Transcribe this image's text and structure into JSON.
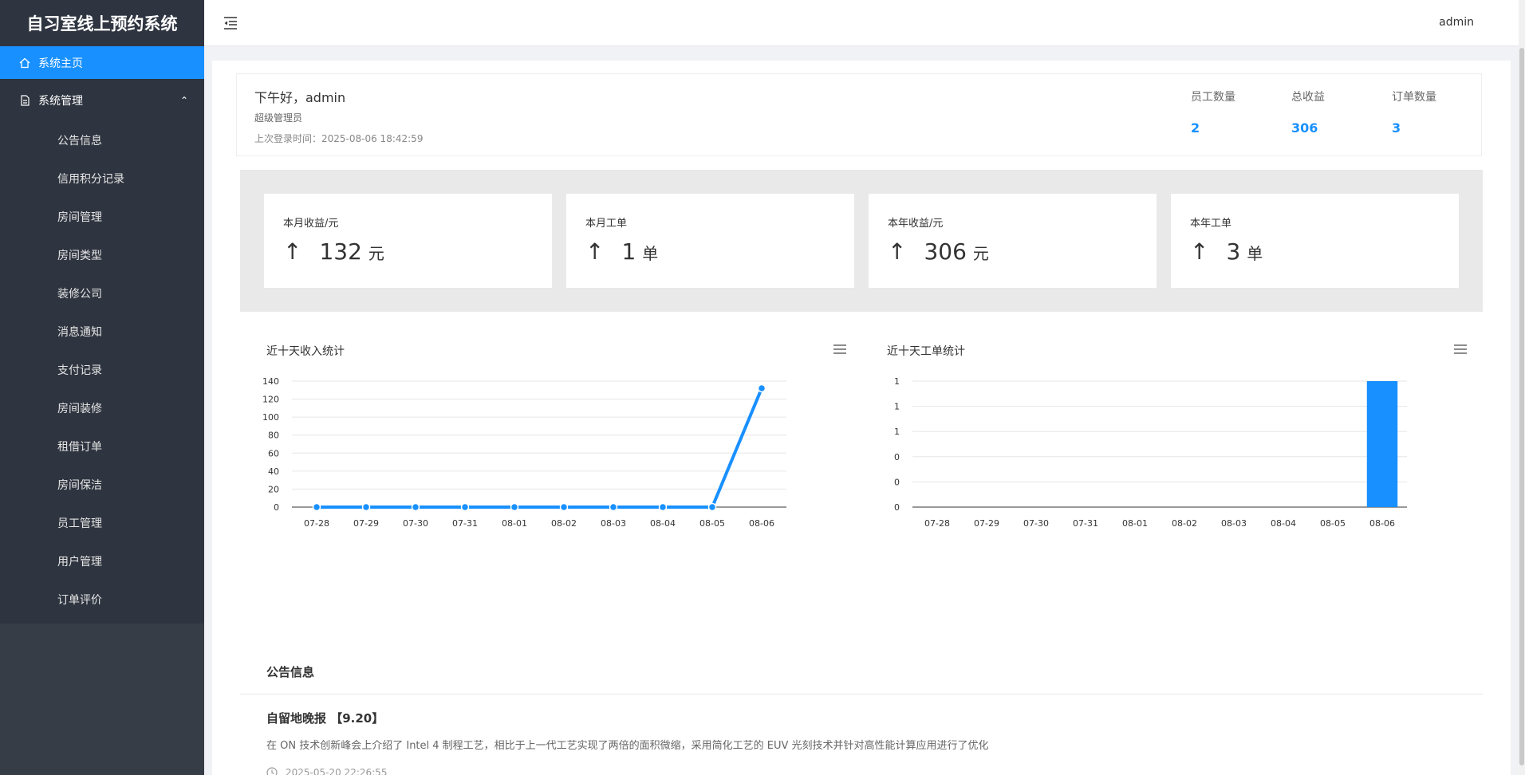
{
  "app": {
    "title": "自习室线上预约系统"
  },
  "sidebar": {
    "home_label": "系统主页",
    "group_label": "系统管理",
    "items": [
      {
        "label": "公告信息"
      },
      {
        "label": "信用积分记录"
      },
      {
        "label": "房间管理"
      },
      {
        "label": "房间类型"
      },
      {
        "label": "装修公司"
      },
      {
        "label": "消息通知"
      },
      {
        "label": "支付记录"
      },
      {
        "label": "房间装修"
      },
      {
        "label": "租借订单"
      },
      {
        "label": "房间保洁"
      },
      {
        "label": "员工管理"
      },
      {
        "label": "用户管理"
      },
      {
        "label": "订单评价"
      }
    ]
  },
  "header": {
    "user": "admin"
  },
  "welcome": {
    "greeting": "下午好，admin",
    "role": "超级管理员",
    "last_login": "上次登录时间：2025-08-06 18:42:59",
    "stats": [
      {
        "label": "员工数量",
        "value": "2"
      },
      {
        "label": "总收益",
        "value": "306"
      },
      {
        "label": "订单数量",
        "value": "3"
      }
    ]
  },
  "cards": [
    {
      "title": "本月收益/元",
      "arrow": "↑",
      "value": "132",
      "unit": "元"
    },
    {
      "title": "本月工单",
      "arrow": "↑",
      "value": "1",
      "unit": "单"
    },
    {
      "title": "本年收益/元",
      "arrow": "↑",
      "value": "306",
      "unit": "元"
    },
    {
      "title": "本年工单",
      "arrow": "↑",
      "value": "3",
      "unit": "单"
    }
  ],
  "chart_data": [
    {
      "type": "line",
      "title": "近十天收入统计",
      "x": [
        "07-28",
        "07-29",
        "07-30",
        "07-31",
        "08-01",
        "08-02",
        "08-03",
        "08-04",
        "08-05",
        "08-06"
      ],
      "values": [
        0,
        0,
        0,
        0,
        0,
        0,
        0,
        0,
        0,
        132
      ],
      "yticks": [
        "0",
        "20",
        "40",
        "60",
        "80",
        "100",
        "120",
        "140"
      ],
      "ylim": [
        0,
        140
      ],
      "color": "#1890ff",
      "grid": true
    },
    {
      "type": "bar",
      "title": "近十天工单统计",
      "x": [
        "07-28",
        "07-29",
        "07-30",
        "07-31",
        "08-01",
        "08-02",
        "08-03",
        "08-04",
        "08-05",
        "08-06"
      ],
      "values": [
        0,
        0,
        0,
        0,
        0,
        0,
        0,
        0,
        0,
        1
      ],
      "yticks": [
        "0",
        "0",
        "0",
        "1",
        "1",
        "1"
      ],
      "ylim": [
        0,
        1
      ],
      "color": "#1890ff",
      "grid": true
    }
  ],
  "notice": {
    "section_title": "公告信息",
    "title": "自留地晚报 【9.20】",
    "body": "在 ON 技术创新峰会上介绍了 Intel 4 制程工艺，相比于上一代工艺实现了两倍的面积微缩，采用简化工艺的 EUV 光刻技术并针对高性能计算应用进行了优化",
    "time": "2025-05-20 22:26:55"
  },
  "icons": {
    "home": "home-icon",
    "doc": "document-icon",
    "fold": "menu-fold-icon",
    "chart_menu": "hamburger-menu-icon",
    "clock": "clock-icon"
  }
}
